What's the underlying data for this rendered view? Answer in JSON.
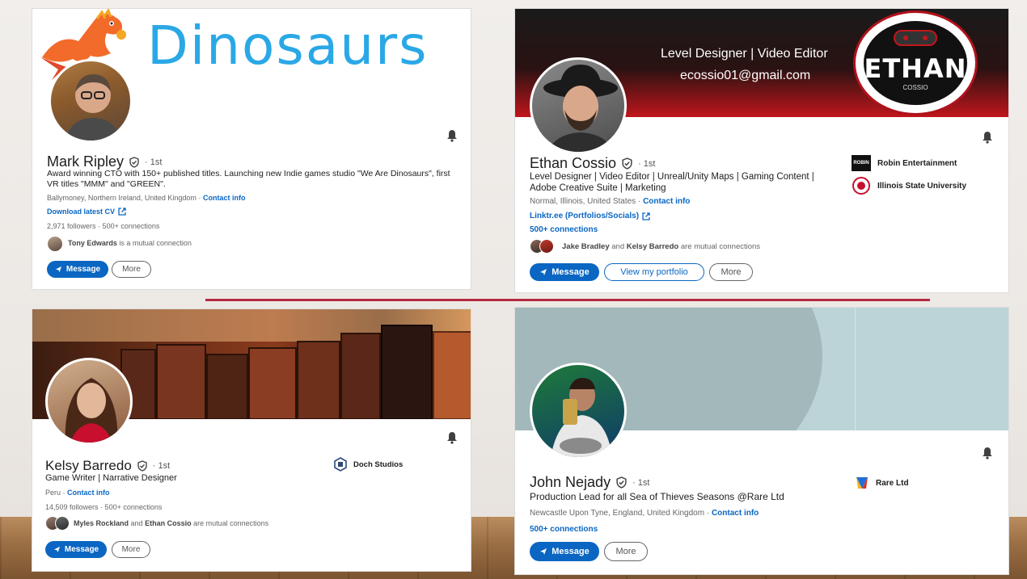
{
  "colors": {
    "accent": "#0a66c2",
    "divider": "#b42a3f"
  },
  "mark": {
    "banner_title": "Dinosaurs",
    "name": "Mark Ripley",
    "degree": "· 1st",
    "headline": "Award winning CTO with 150+ published titles. Launching new Indie games studio \"We Are Dinosaurs\", first VR titles \"MMM\" and \"GREEN\".",
    "location": "Ballymoney, Northern Ireland, United Kingdom ·",
    "contact": "Contact info",
    "cv_link": "Download latest CV",
    "followers": "2,971 followers",
    "connections": "· 500+ connections",
    "mutual_name": "Tony Edwards",
    "mutual_text": "is a mutual connection",
    "message": "Message",
    "more": "More"
  },
  "ethan": {
    "banner_line1": "Level Designer | Video Editor",
    "banner_line2": "ecossio01@gmail.com",
    "logo_text": "ETHAN",
    "logo_sub": "COSSIO",
    "name": "Ethan Cossio",
    "degree": "· 1st",
    "headline": "Level Designer | Video Editor | Unreal/Unity Maps | Gaming Content | Adobe Creative Suite | Marketing",
    "location": "Normal, Illinois, United States ·",
    "contact": "Contact info",
    "linktree": "Linktr.ee (Portfolios/Socials)",
    "connections": "500+ connections",
    "mutual_a": "Jake Bradley",
    "mutual_and": "and",
    "mutual_b": "Kelsy Barredo",
    "mutual_text": "are mutual connections",
    "org1_logo": "ROBIN",
    "org1": "Robin Entertainment",
    "org2": "Illinois State University",
    "message": "Message",
    "portfolio": "View my portfolio",
    "more": "More"
  },
  "kelsy": {
    "name": "Kelsy Barredo",
    "degree": "· 1st",
    "headline": "Game Writer | Narrative Designer",
    "location": "Peru ·",
    "contact": "Contact info",
    "followers": "14,509 followers",
    "connections": "· 500+ connections",
    "mutual_a": "Myles Rockland",
    "mutual_and": "and",
    "mutual_b": "Ethan Cossio",
    "mutual_text": "are mutual connections",
    "org1": "Doch Studios",
    "message": "Message",
    "more": "More"
  },
  "john": {
    "name": "John Nejady",
    "degree": "· 1st",
    "headline": "Production Lead for all Sea of Thieves Seasons @Rare Ltd",
    "location": "Newcastle Upon Tyne, England, United Kingdom ·",
    "contact": "Contact info",
    "connections": "500+ connections",
    "org1": "Rare Ltd",
    "message": "Message",
    "more": "More"
  }
}
